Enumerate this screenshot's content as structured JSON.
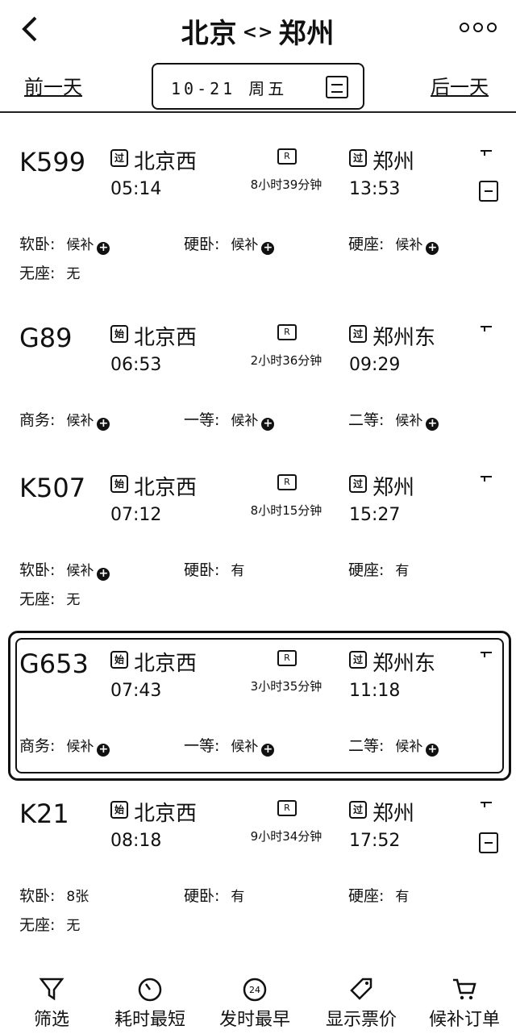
{
  "header": {
    "from": "北京",
    "arrow": "<>",
    "to": "郑州",
    "prev_day": "前一天",
    "next_day": "后一天",
    "date_text": "10-21 周五",
    "icons": {
      "back": "back-chevron-icon",
      "more": "more-dots-icon",
      "calendar": "calendar-icon"
    }
  },
  "trains": [
    {
      "no": "K599",
      "from_badge": "过",
      "from_station": "北京西",
      "depart": "05:14",
      "duration": "8小时39分钟",
      "to_badge": "过",
      "to_station": "郑州",
      "arrive": "13:53",
      "has_ticket_icon": true,
      "seats": [
        {
          "label": "软卧:",
          "avail": "候补",
          "plus": true
        },
        {
          "label": "硬卧:",
          "avail": "候补",
          "plus": true
        },
        {
          "label": "硬座:",
          "avail": "候补",
          "plus": true
        },
        {
          "label": "无座:",
          "avail": "无",
          "plus": false
        }
      ]
    },
    {
      "no": "G89",
      "from_badge": "始",
      "from_station": "北京西",
      "depart": "06:53",
      "duration": "2小时36分钟",
      "to_badge": "过",
      "to_station": "郑州东",
      "arrive": "09:29",
      "has_ticket_icon": false,
      "seats": [
        {
          "label": "商务:",
          "avail": "候补",
          "plus": true
        },
        {
          "label": "一等:",
          "avail": "候补",
          "plus": true
        },
        {
          "label": "二等:",
          "avail": "候补",
          "plus": true
        }
      ]
    },
    {
      "no": "K507",
      "from_badge": "始",
      "from_station": "北京西",
      "depart": "07:12",
      "duration": "8小时15分钟",
      "to_badge": "过",
      "to_station": "郑州",
      "arrive": "15:27",
      "has_ticket_icon": false,
      "seats": [
        {
          "label": "软卧:",
          "avail": "候补",
          "plus": true
        },
        {
          "label": "硬卧:",
          "avail": "有",
          "plus": false
        },
        {
          "label": "硬座:",
          "avail": "有",
          "plus": false
        },
        {
          "label": "无座:",
          "avail": "无",
          "plus": false
        }
      ]
    },
    {
      "no": "G653",
      "from_badge": "始",
      "from_station": "北京西",
      "depart": "07:43",
      "duration": "3小时35分钟",
      "to_badge": "过",
      "to_station": "郑州东",
      "arrive": "11:18",
      "has_ticket_icon": false,
      "highlighted": true,
      "seats": [
        {
          "label": "商务:",
          "avail": "候补",
          "plus": true
        },
        {
          "label": "一等:",
          "avail": "候补",
          "plus": true
        },
        {
          "label": "二等:",
          "avail": "候补",
          "plus": true
        }
      ]
    },
    {
      "no": "K21",
      "from_badge": "始",
      "from_station": "北京西",
      "depart": "08:18",
      "duration": "9小时34分钟",
      "to_badge": "过",
      "to_station": "郑州",
      "arrive": "17:52",
      "has_ticket_icon": true,
      "seats": [
        {
          "label": "软卧:",
          "avail": "8张",
          "plus": false
        },
        {
          "label": "硬卧:",
          "avail": "有",
          "plus": false
        },
        {
          "label": "硬座:",
          "avail": "有",
          "plus": false
        },
        {
          "label": "无座:",
          "avail": "无",
          "plus": false
        }
      ]
    }
  ],
  "route_icon_label": "R",
  "bottom_bar": [
    {
      "label": "筛选",
      "icon": "filter-icon"
    },
    {
      "label": "耗时最短",
      "icon": "timer-icon"
    },
    {
      "label": "发时最早",
      "icon": "clock-24-icon",
      "icon_text": "24"
    },
    {
      "label": "显示票价",
      "icon": "price-tag-icon"
    },
    {
      "label": "候补订单",
      "icon": "cart-icon"
    }
  ]
}
